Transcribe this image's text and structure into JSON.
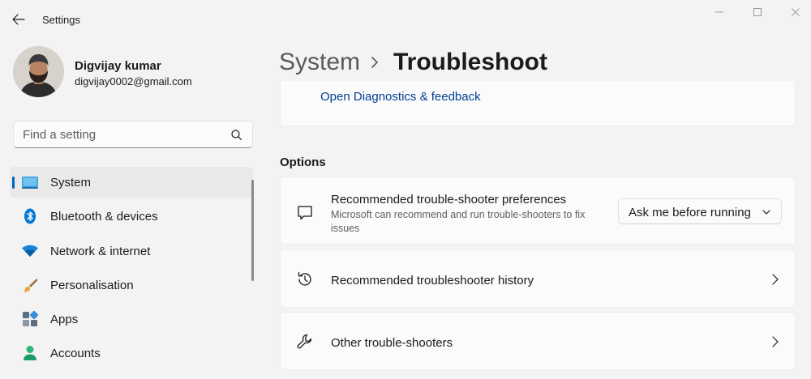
{
  "window": {
    "title": "Settings",
    "controls": {
      "minimize": "minimize",
      "maximize": "maximize",
      "close": "close"
    }
  },
  "profile": {
    "name": "Digvijay kumar",
    "email": "digvijay0002@gmail.com"
  },
  "search": {
    "placeholder": "Find a setting"
  },
  "sidebar": {
    "items": [
      {
        "label": "System",
        "icon": "monitor-icon",
        "active": true
      },
      {
        "label": "Bluetooth & devices",
        "icon": "bluetooth-icon",
        "active": false
      },
      {
        "label": "Network & internet",
        "icon": "wifi-icon",
        "active": false
      },
      {
        "label": "Personalisation",
        "icon": "brush-icon",
        "active": false
      },
      {
        "label": "Apps",
        "icon": "apps-icon",
        "active": false
      },
      {
        "label": "Accounts",
        "icon": "person-icon",
        "active": false
      }
    ]
  },
  "header": {
    "parent": "System",
    "current": "Troubleshoot"
  },
  "main": {
    "diagnostics_link": "Open Diagnostics & feedback",
    "options_title": "Options",
    "preferences": {
      "title": "Recommended trouble-shooter preferences",
      "description": "Microsoft can recommend and run trouble-shooters to fix issues",
      "selected": "Ask me before running"
    },
    "history": {
      "title": "Recommended troubleshooter history"
    },
    "others": {
      "title": "Other trouble-shooters"
    }
  },
  "colors": {
    "accent": "#0067c0",
    "link": "#003e92",
    "background": "#f3f3f3",
    "card": "#fbfbfb"
  }
}
